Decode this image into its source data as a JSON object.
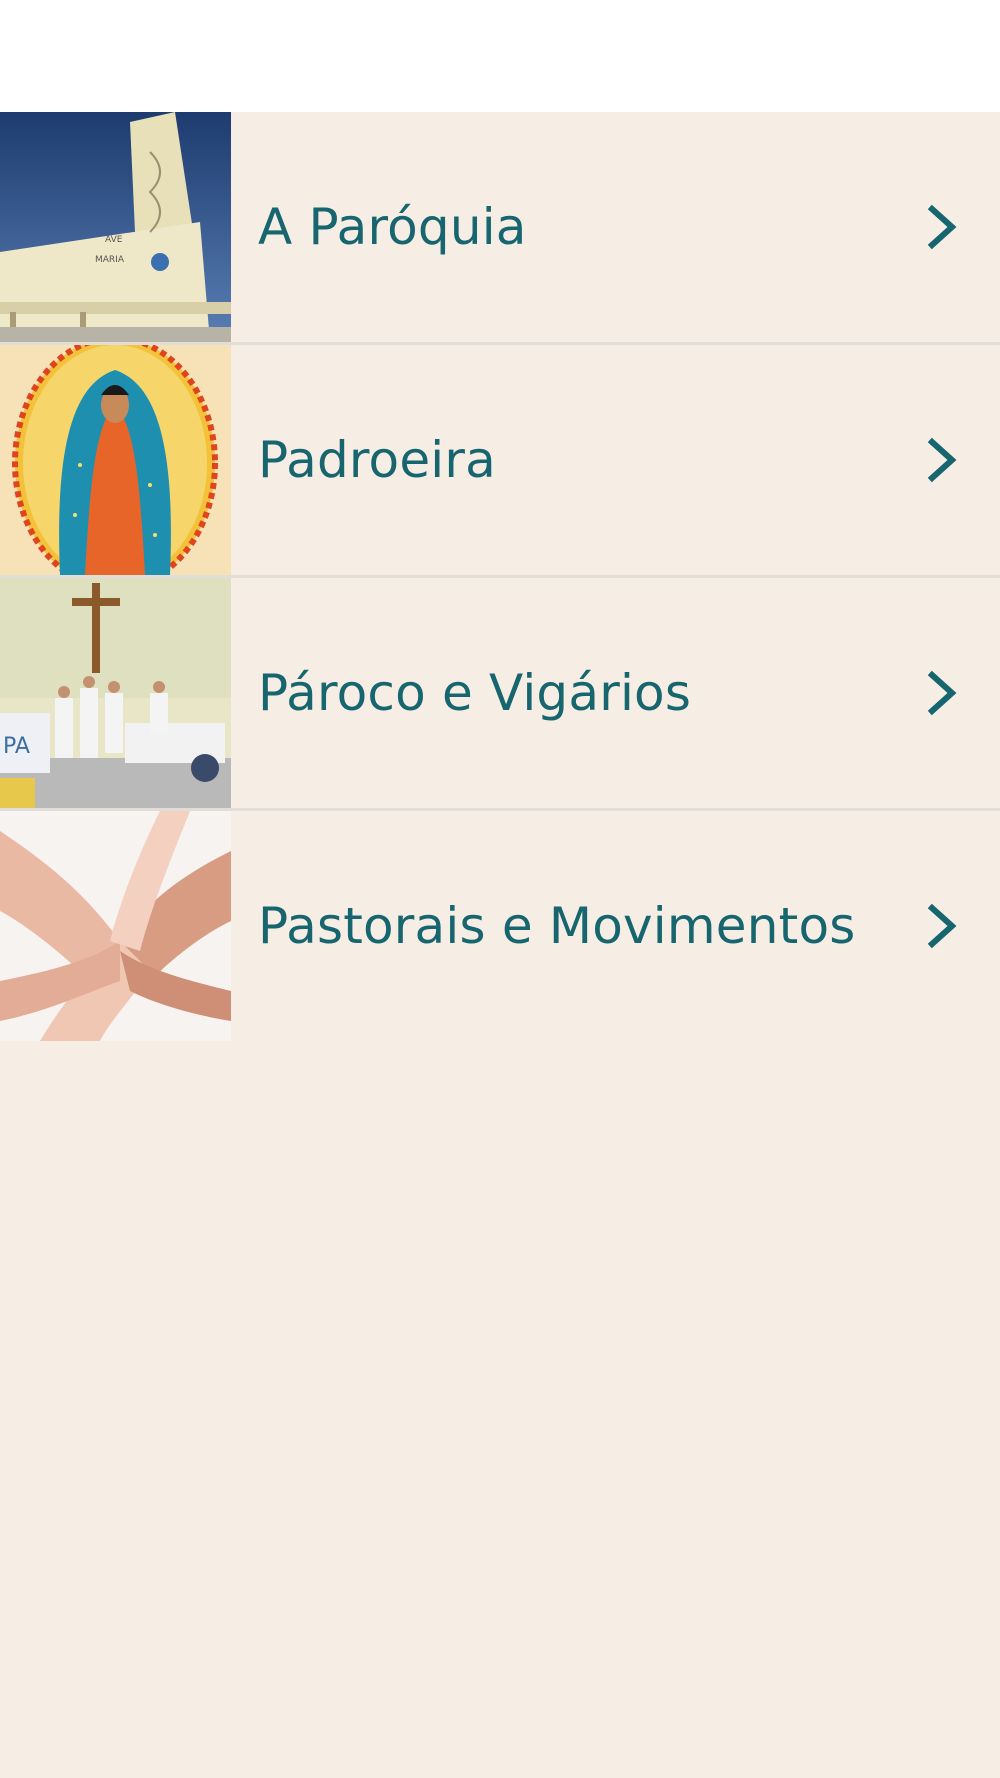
{
  "theme": {
    "background": "#f6eee5",
    "accent": "#17656e",
    "divider": "#e2ddd6",
    "header": "#ffffff"
  },
  "menu": {
    "items": [
      {
        "label": "A Paróquia",
        "thumbnail": "church-building-photo",
        "icon": "chevron-right-icon"
      },
      {
        "label": "Padroeira",
        "thumbnail": "our-lady-of-guadalupe-image",
        "icon": "chevron-right-icon"
      },
      {
        "label": "Pároco e Vigários",
        "thumbnail": "priests-at-altar-photo",
        "icon": "chevron-right-icon"
      },
      {
        "label": "Pastorais e Movimentos",
        "thumbnail": "stacked-hands-photo",
        "icon": "chevron-right-icon"
      }
    ]
  }
}
